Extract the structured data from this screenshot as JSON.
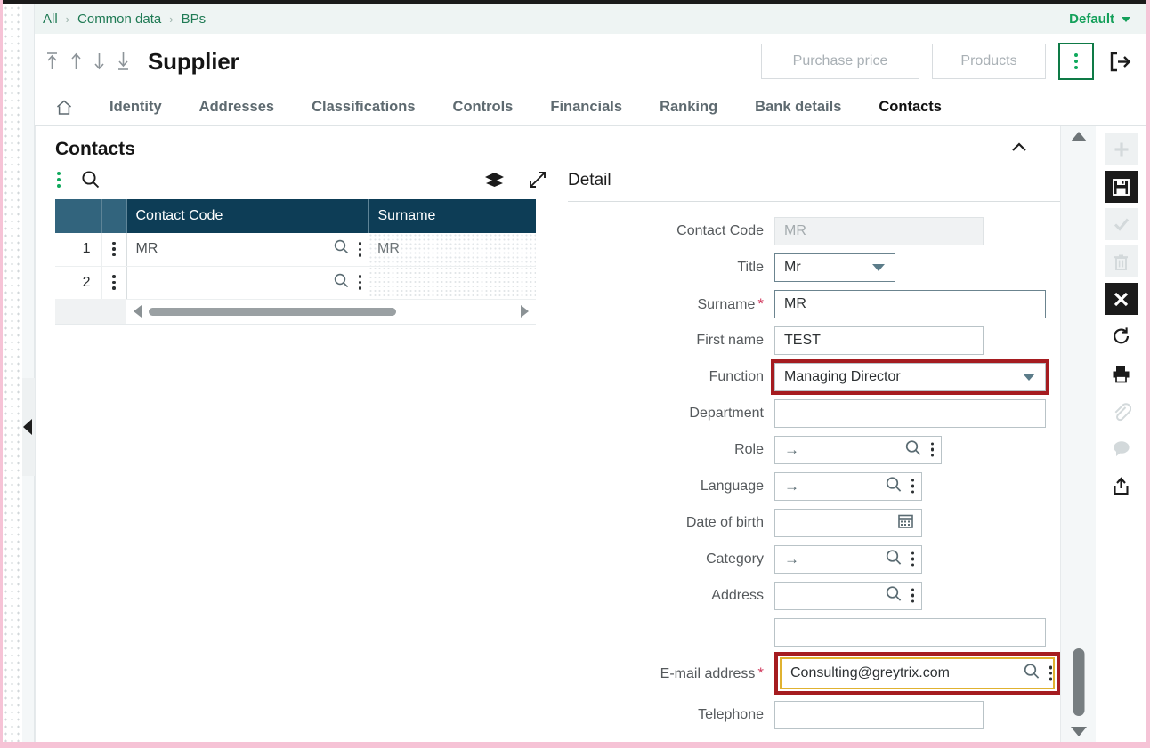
{
  "breadcrumb": {
    "items": [
      "All",
      "Common data",
      "BPs"
    ],
    "separator": "›"
  },
  "environment": {
    "label": "Default"
  },
  "header": {
    "title": "Supplier",
    "nav_icons": [
      "first-arrow-icon",
      "previous-arrow-icon",
      "next-arrow-icon",
      "last-arrow-icon"
    ],
    "buttons": [
      {
        "label": "Purchase price",
        "name": "purchase-price-button"
      },
      {
        "label": "Products",
        "name": "products-button"
      }
    ],
    "kebab_label": "More actions",
    "exit_label": "Exit"
  },
  "tabs": [
    {
      "label": "Identity",
      "active": false
    },
    {
      "label": "Addresses",
      "active": false
    },
    {
      "label": "Classifications",
      "active": false
    },
    {
      "label": "Controls",
      "active": false
    },
    {
      "label": "Financials",
      "active": false
    },
    {
      "label": "Ranking",
      "active": false
    },
    {
      "label": "Bank details",
      "active": false
    },
    {
      "label": "Contacts",
      "active": true
    }
  ],
  "section": {
    "title": "Contacts",
    "collapse_icon": "chevron-up-icon"
  },
  "grid": {
    "columns": [
      "",
      "",
      "Contact Code",
      "Surname"
    ],
    "rows": [
      {
        "num": "1",
        "contact_code": "MR",
        "surname": "MR"
      },
      {
        "num": "2",
        "contact_code": "",
        "surname": ""
      }
    ],
    "toolbar_icons": [
      "grid-menu-icon",
      "search-icon",
      "layers-icon",
      "expand-icon"
    ]
  },
  "detail": {
    "title": "Detail",
    "fields": {
      "contact_code": {
        "label": "Contact Code",
        "value": "MR",
        "required": false,
        "disabled": true
      },
      "title": {
        "label": "Title",
        "value": "Mr",
        "required": false
      },
      "surname": {
        "label": "Surname",
        "value": "MR",
        "required": true
      },
      "first_name": {
        "label": "First name",
        "value": "TEST",
        "required": false
      },
      "function": {
        "label": "Function",
        "value": "Managing Director",
        "required": false,
        "highlight": "red"
      },
      "department": {
        "label": "Department",
        "value": "",
        "required": false
      },
      "role": {
        "label": "Role",
        "value": "",
        "required": false
      },
      "language": {
        "label": "Language",
        "value": "",
        "required": false
      },
      "date_of_birth": {
        "label": "Date of birth",
        "value": "",
        "required": false
      },
      "category": {
        "label": "Category",
        "value": "",
        "required": false
      },
      "address": {
        "label": "Address",
        "value": "",
        "required": false
      },
      "extra": {
        "label": "",
        "value": ""
      },
      "email_address": {
        "label": "E-mail address",
        "value": "Consulting@greytrix.com",
        "required": true,
        "highlight": "red-gold"
      },
      "telephone": {
        "label": "Telephone",
        "value": "",
        "required": false
      }
    }
  },
  "right_toolbar": [
    {
      "name": "add-icon",
      "state": "disabled"
    },
    {
      "name": "save-icon",
      "state": "active"
    },
    {
      "name": "confirm-check-icon",
      "state": "disabled"
    },
    {
      "name": "delete-trash-icon",
      "state": "disabled"
    },
    {
      "name": "close-x-icon",
      "state": "active"
    },
    {
      "name": "refresh-icon",
      "state": "plain"
    },
    {
      "name": "print-icon",
      "state": "plain"
    },
    {
      "name": "attachment-icon",
      "state": "disabled"
    },
    {
      "name": "comment-icon",
      "state": "disabled"
    },
    {
      "name": "share-export-icon",
      "state": "plain"
    }
  ],
  "colors": {
    "grid_header": "#0d3d56",
    "accent_green": "#0fa95c",
    "highlight_red": "#a51c20",
    "highlight_gold": "#e0b230",
    "required_star": "#d13a5e",
    "page_border_pink": "#f6c3d6"
  }
}
